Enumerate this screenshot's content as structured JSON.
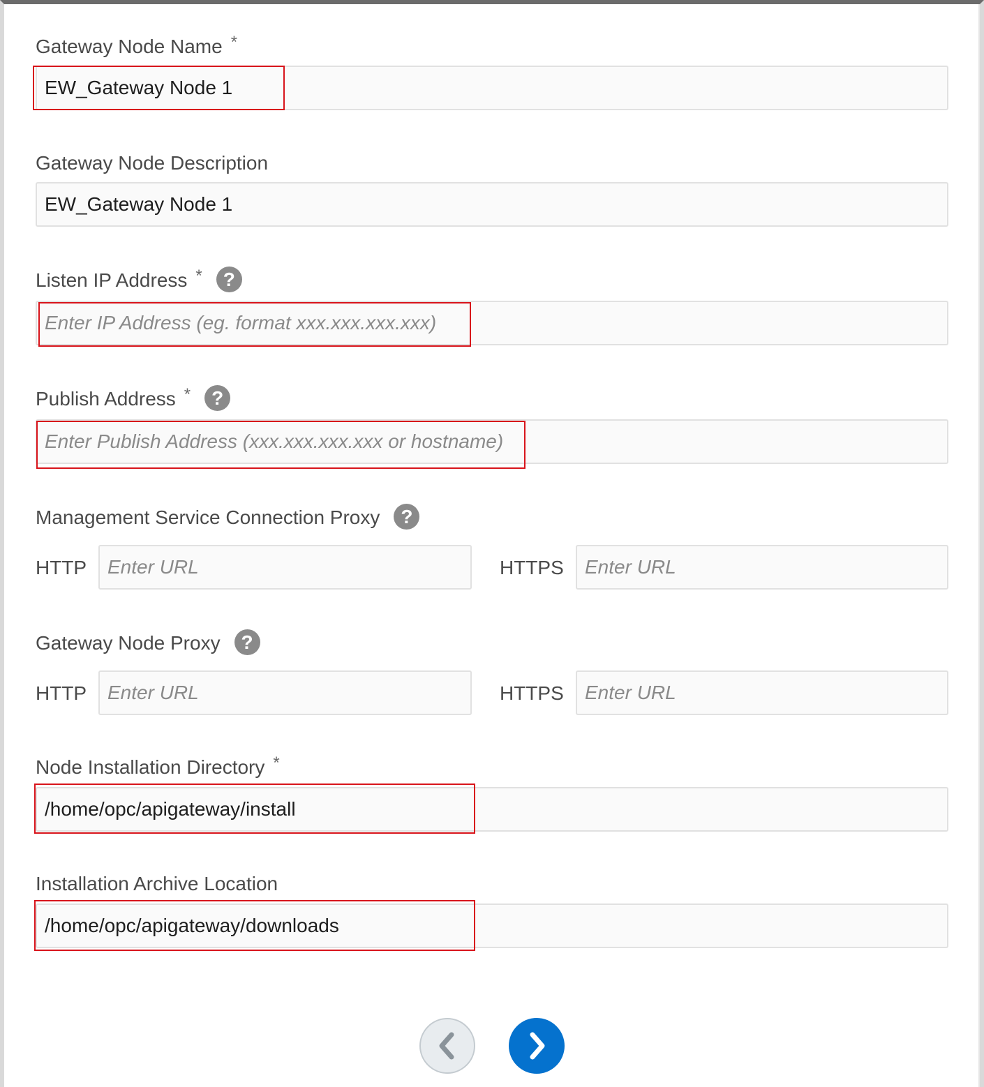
{
  "form": {
    "gateway_node_name": {
      "label": "Gateway Node Name",
      "required_mark": "*",
      "value": "EW_Gateway Node 1"
    },
    "gateway_node_description": {
      "label": "Gateway Node Description",
      "value": "EW_Gateway Node 1"
    },
    "listen_ip_address": {
      "label": "Listen IP Address",
      "required_mark": "*",
      "help_icon": "?",
      "placeholder": "Enter IP Address (eg. format xxx.xxx.xxx.xxx)"
    },
    "publish_address": {
      "label": "Publish Address",
      "required_mark": "*",
      "help_icon": "?",
      "placeholder": "Enter Publish Address (xxx.xxx.xxx.xxx or hostname)"
    },
    "management_proxy": {
      "label": "Management Service Connection Proxy",
      "help_icon": "?",
      "http_label": "HTTP",
      "http_placeholder": "Enter URL",
      "https_label": "HTTPS",
      "https_placeholder": "Enter URL"
    },
    "gateway_node_proxy": {
      "label": "Gateway Node Proxy",
      "help_icon": "?",
      "http_label": "HTTP",
      "http_placeholder": "Enter URL",
      "https_label": "HTTPS",
      "https_placeholder": "Enter URL"
    },
    "node_installation_directory": {
      "label": "Node Installation Directory",
      "required_mark": "*",
      "value": "/home/opc/apigateway/install"
    },
    "installation_archive_location": {
      "label": "Installation Archive Location",
      "value": "/home/opc/apigateway/downloads"
    }
  },
  "navigation": {
    "previous_icon": "chevron-left-icon",
    "next_icon": "chevron-right-icon"
  },
  "colors": {
    "highlight": "#d8141b",
    "next_button": "#0572ce",
    "help_icon": "#8a8a8a"
  }
}
